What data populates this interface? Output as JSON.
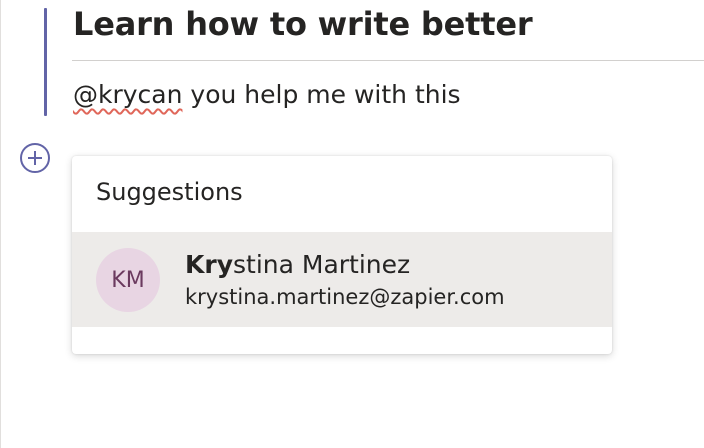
{
  "compose": {
    "subject": "Learn how to write better",
    "message_mention": "@krycan",
    "message_rest": " you help me with this",
    "accent_color": "#6264a7"
  },
  "toolbar": {
    "add_icon": "plus-circle-icon"
  },
  "suggestions": {
    "header": "Suggestions",
    "items": [
      {
        "initials": "KM",
        "name_match": "Kry",
        "name_rest": "stina Martinez",
        "email": "krystina.martinez@zapier.com",
        "avatar_color": "#e8d5e3"
      }
    ]
  }
}
